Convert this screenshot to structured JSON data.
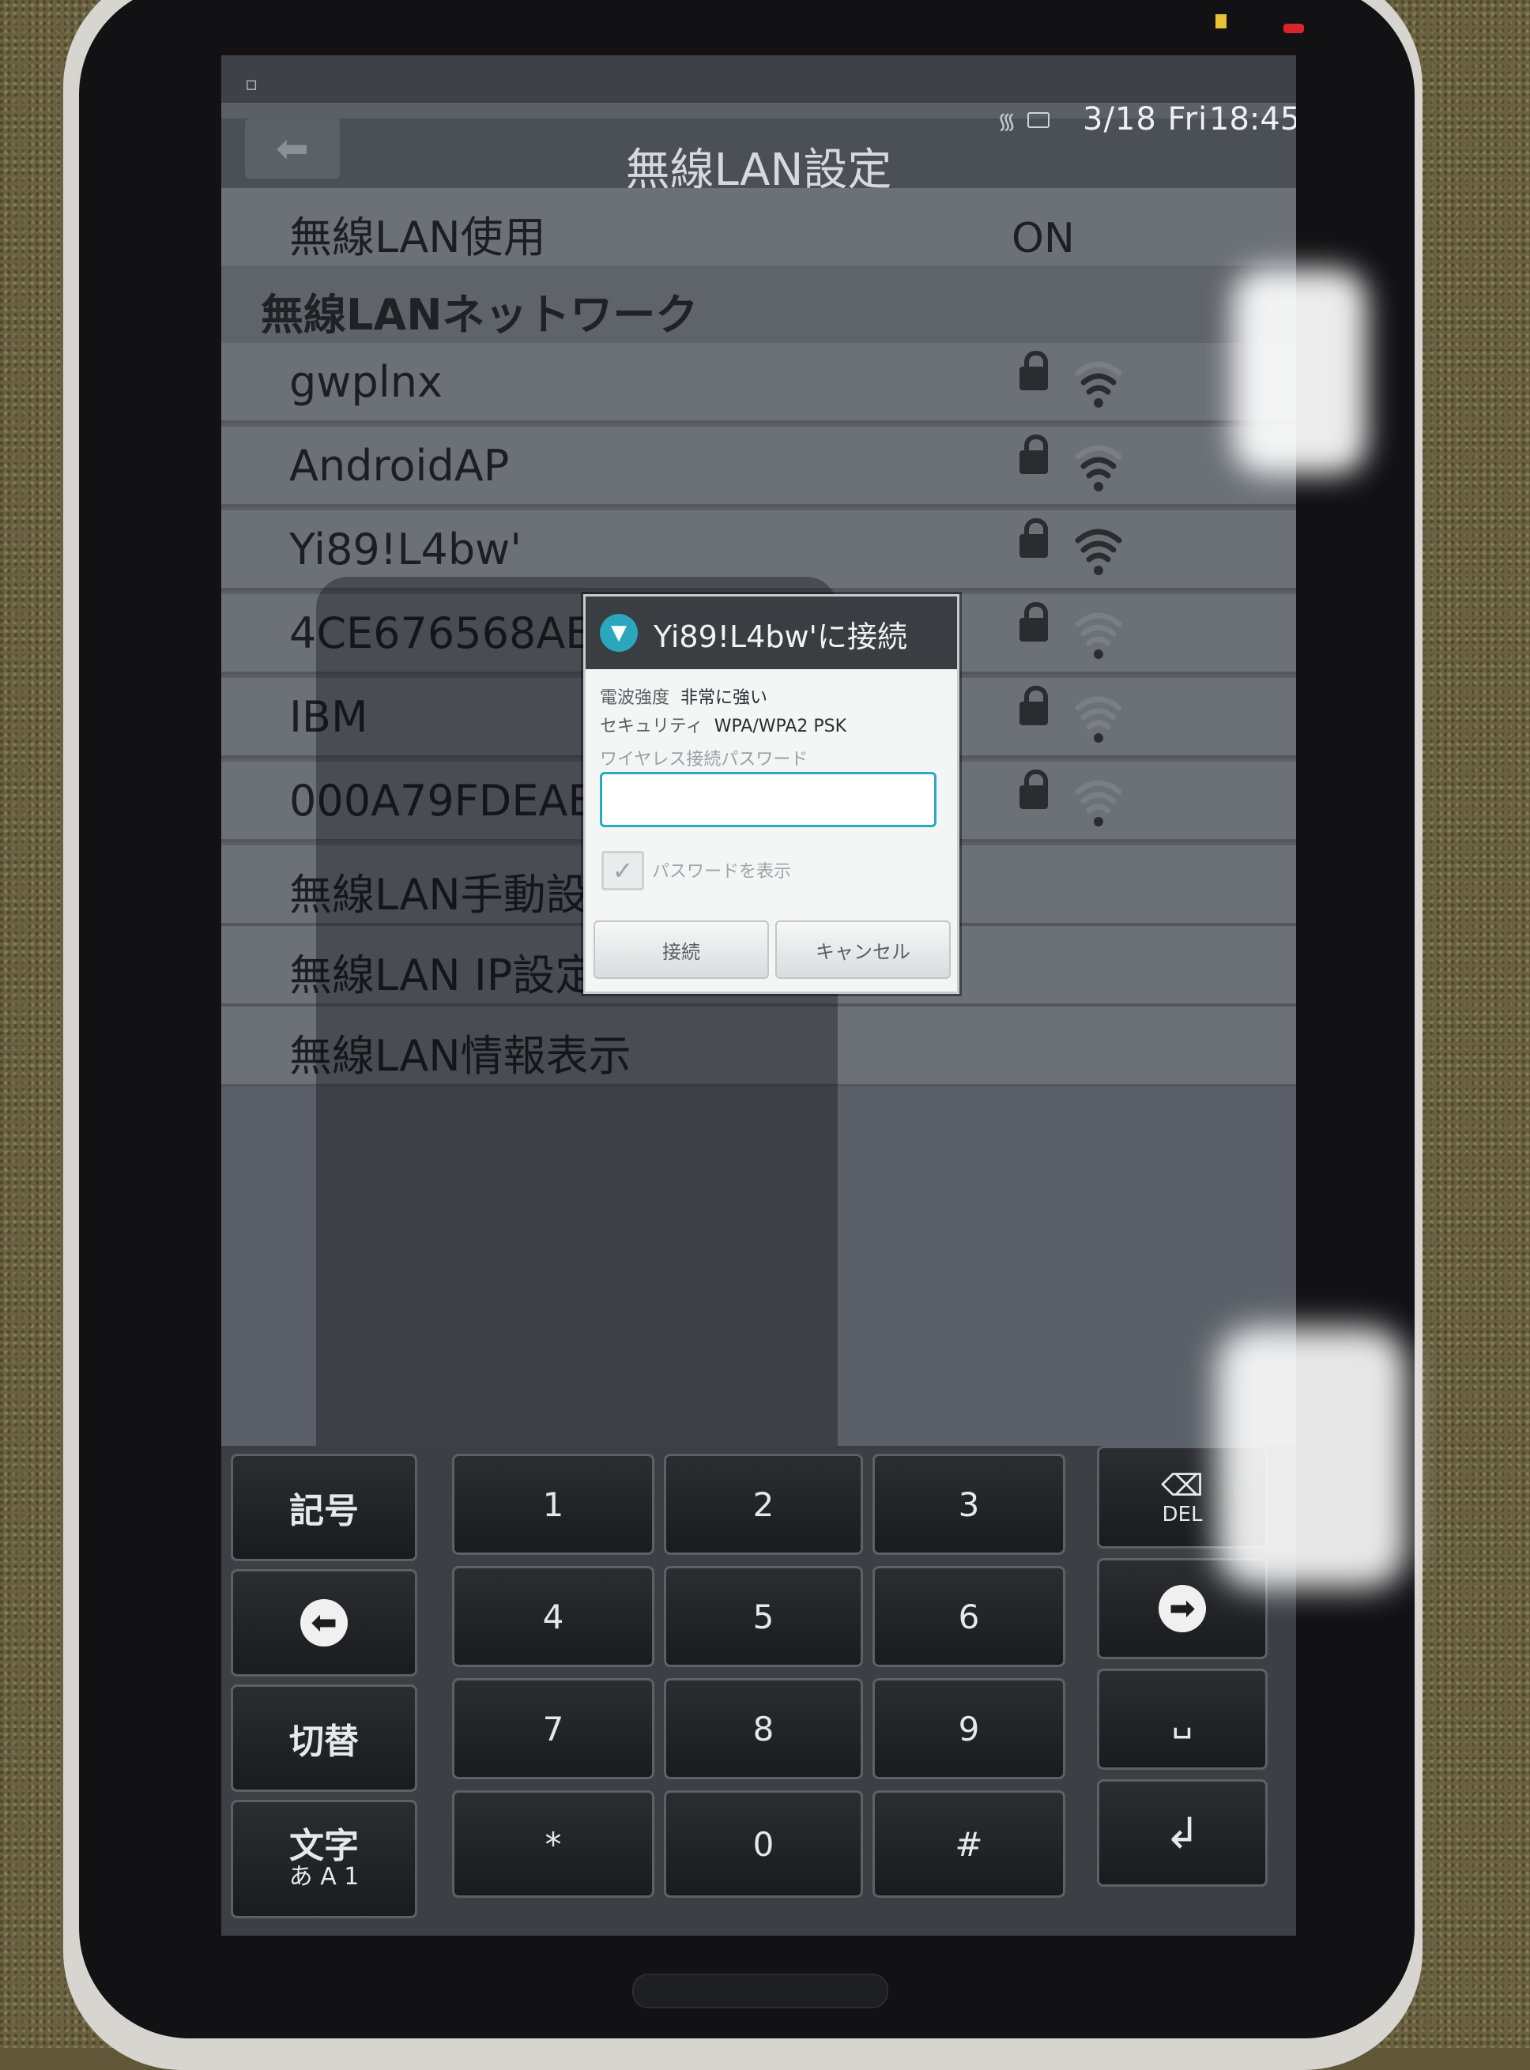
{
  "status_bar": {
    "date": "3/18 Fri",
    "time": "18:45"
  },
  "header": {
    "title": "無線LAN設定"
  },
  "wifi_toggle": {
    "label": "無線LAN使用",
    "value": "ON"
  },
  "network_section": {
    "label": "無線LANネットワーク"
  },
  "networks": [
    {
      "name": "gwplnx",
      "signal": 0.75,
      "secured": true
    },
    {
      "name": "AndroidAP",
      "signal": 0.75,
      "secured": true
    },
    {
      "name": "Yi89!L4bw'",
      "signal": 1.0,
      "secured": true
    },
    {
      "name": "4CE676568ABE",
      "signal": 0.25,
      "secured": true
    },
    {
      "name": "IBM",
      "signal": 0.25,
      "secured": true
    },
    {
      "name": "000A79FDEABD",
      "signal": 0.25,
      "secured": true
    }
  ],
  "menu": [
    {
      "label": "無線LAN手動設定"
    },
    {
      "label": "無線LAN IP設定"
    },
    {
      "label": "無線LAN情報表示"
    }
  ],
  "dialog": {
    "title": "Yi89!L4bw'に接続",
    "signal_label": "電波強度",
    "signal_value": "非常に強い",
    "security_label": "セキュリティ",
    "security_value": "WPA/WPA2 PSK",
    "password_hint": "ワイヤレス接続パスワード",
    "password_value": "",
    "show_password_label": "パスワードを表示",
    "connect_label": "接続",
    "cancel_label": "キャンセル"
  },
  "keyboard": {
    "symbol": "記号",
    "switch": "切替",
    "mode_top": "文字",
    "mode_bottom": "あ A 1",
    "del": "DEL",
    "keys": [
      "1",
      "2",
      "3",
      "4",
      "5",
      "6",
      "7",
      "8",
      "9",
      "*",
      "0",
      "#"
    ]
  },
  "colors": {
    "accent": "#27aabf",
    "screen_bg": "#5b6068",
    "row_bg": "#6c7178"
  }
}
